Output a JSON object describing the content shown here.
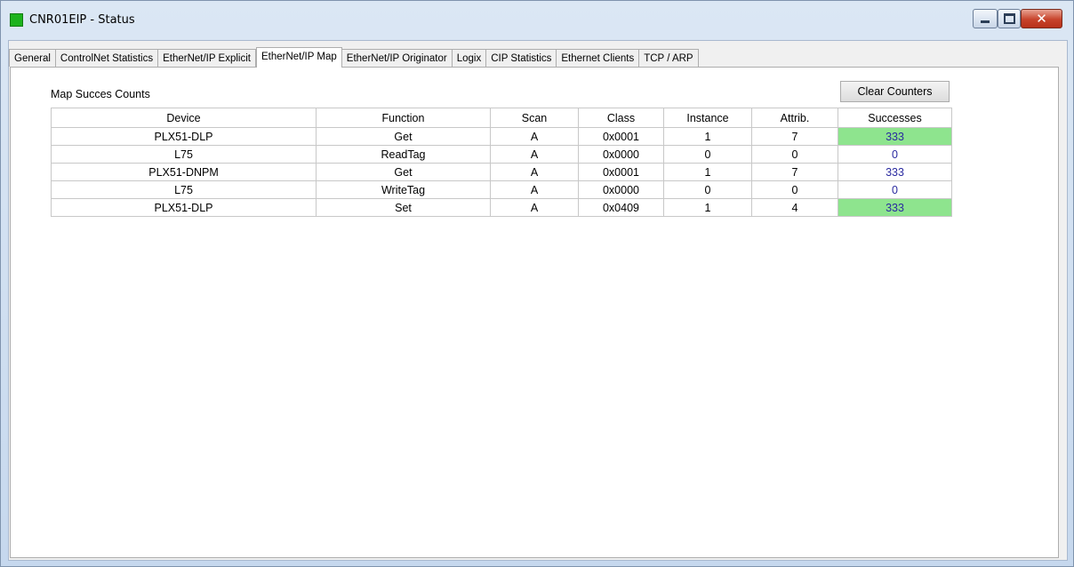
{
  "window": {
    "title": "CNR01EIP - Status",
    "close_glyph": "✕"
  },
  "tabs": [
    {
      "label": "General"
    },
    {
      "label": "ControlNet Statistics"
    },
    {
      "label": "EtherNet/IP Explicit"
    },
    {
      "label": "EtherNet/IP Map"
    },
    {
      "label": "EtherNet/IP Originator"
    },
    {
      "label": "Logix"
    },
    {
      "label": "CIP Statistics"
    },
    {
      "label": "Ethernet Clients"
    },
    {
      "label": "TCP / ARP"
    }
  ],
  "active_tab": "EtherNet/IP Map",
  "panel": {
    "section_label": "Map Succes Counts",
    "clear_button": "Clear Counters"
  },
  "table": {
    "headers": [
      "Device",
      "Function",
      "Scan",
      "Class",
      "Instance",
      "Attrib.",
      "Successes"
    ],
    "rows": [
      [
        "PLX51-DLP",
        "Get",
        "A",
        "0x0001",
        "1",
        "7",
        "333"
      ],
      [
        "L75",
        "ReadTag",
        "A",
        "0x0000",
        "0",
        "0",
        "0"
      ],
      [
        "PLX51-DNPM",
        "Get",
        "A",
        "0x0001",
        "1",
        "7",
        "333"
      ],
      [
        "L75",
        "WriteTag",
        "A",
        "0x0000",
        "0",
        "0",
        "0"
      ],
      [
        "PLX51-DLP",
        "Set",
        "A",
        "0x0409",
        "1",
        "4",
        "333"
      ]
    ],
    "highlighted_rows": [
      true,
      false,
      false,
      false,
      true
    ]
  },
  "colors": {
    "highlight": "#8ee48e",
    "success_text": "#2a2aa0",
    "status_icon": "#1db31d"
  }
}
